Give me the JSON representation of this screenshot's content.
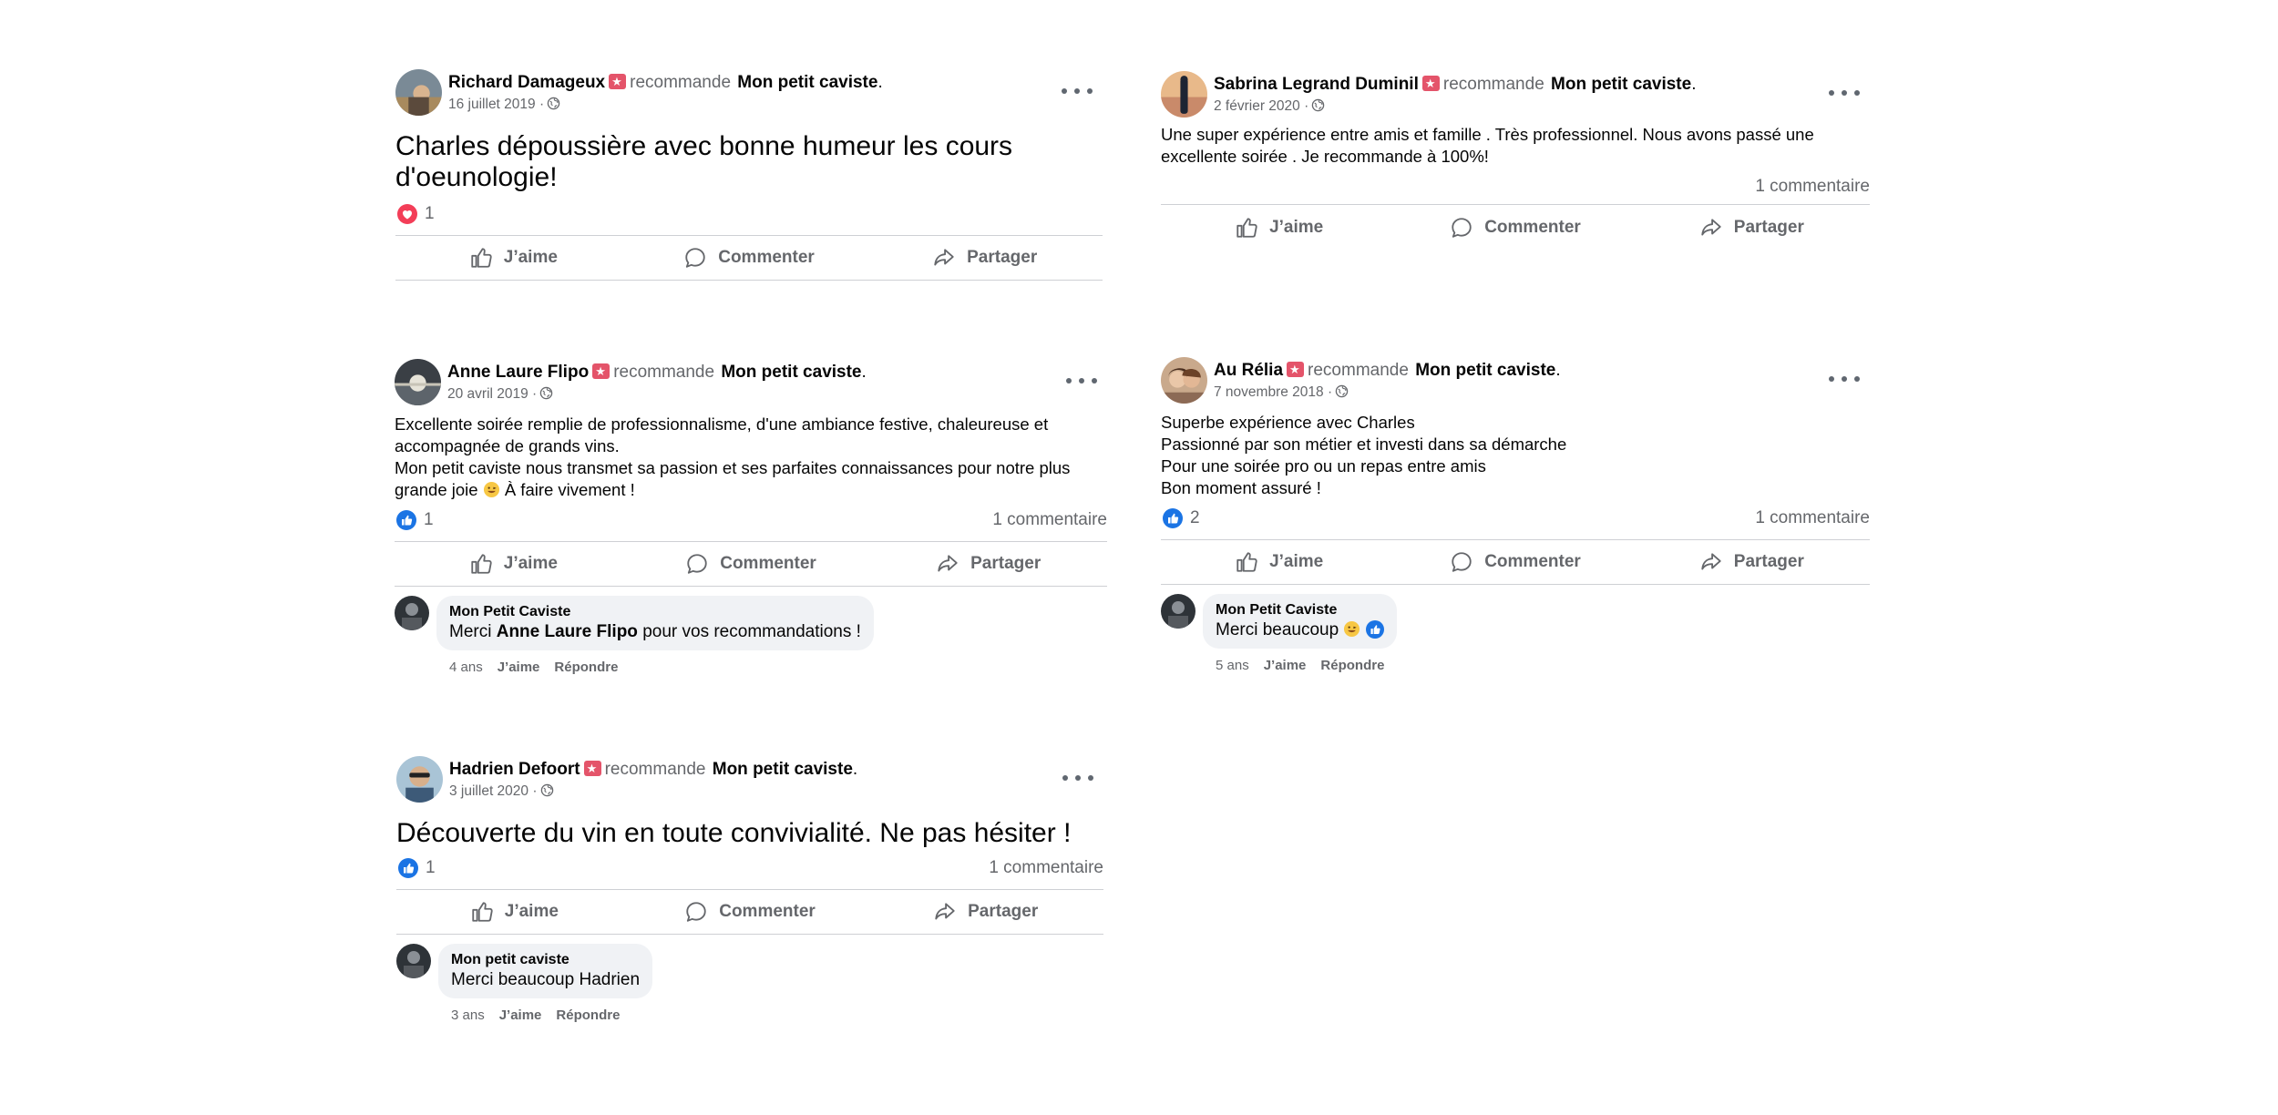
{
  "common": {
    "verb": "recommande",
    "page": "Mon petit caviste",
    "period": ".",
    "like_label": "J’aime",
    "comment_label": "Commenter",
    "share_label": "Partager",
    "reply_label": "Répondre",
    "c_like_label": "J’aime"
  },
  "posts": [
    {
      "author": "Richard Damageux",
      "date": "16 juillet 2019 ·",
      "text": "Charles dépoussière avec bonne humeur les cours d'oeunologie!",
      "reaction": "heart",
      "reaction_count": "1"
    },
    {
      "author": "Sabrina Legrand Duminil",
      "date": "2 février 2020 ·",
      "text": "Une super expérience entre amis et famille . Très professionnel. Nous avons passé une excellente soirée . Je recommande à 100%!",
      "comment_count": "1 commentaire"
    },
    {
      "author": "Anne Laure Flipo",
      "date": "20 avril 2019 ·",
      "text_lines": [
        "Excellente soirée remplie de professionnalisme, d'une ambiance festive, chaleureuse et",
        "accompagnée de grands vins.",
        "Mon petit caviste nous transmet sa passion et ses parfaites connaissances pour notre plus",
        "grande joie",
        "À faire vivement !"
      ],
      "reaction": "like",
      "reaction_count": "1",
      "comment_count": "1 commentaire",
      "comment": {
        "author": "Mon Petit Caviste",
        "prefix": "Merci",
        "mention": "Anne Laure Flipo",
        "suffix": "pour vos recommandations !",
        "age": "4 ans"
      }
    },
    {
      "author": "Au Rélia",
      "date": "7 novembre 2018 ·",
      "text": "Superbe expérience avec Charles\nPassionné par son métier et investi dans sa démarche\nPour une soirée pro ou un repas entre amis\nBon moment assuré !",
      "reaction": "like",
      "reaction_count": "2",
      "comment_count": "1 commentaire",
      "comment": {
        "author": "Mon Petit Caviste",
        "text": "Merci beaucoup",
        "age": "5 ans"
      }
    },
    {
      "author": "Hadrien Defoort",
      "date": "3 juillet 2020 ·",
      "text": "Découverte du vin en toute convivialité. Ne pas hésiter !",
      "reaction": "like",
      "reaction_count": "1",
      "comment_count": "1 commentaire",
      "comment": {
        "author": "Mon petit caviste",
        "text": "Merci beaucoup Hadrien",
        "age": "3 ans"
      }
    }
  ],
  "colors": {
    "like_blue": "#1b74e4",
    "heart_red": "#f33e58",
    "recommend_red": "#e4546a",
    "secondary_text": "#65676b",
    "divider": "#ced0d4",
    "bubble": "#f0f2f5"
  }
}
